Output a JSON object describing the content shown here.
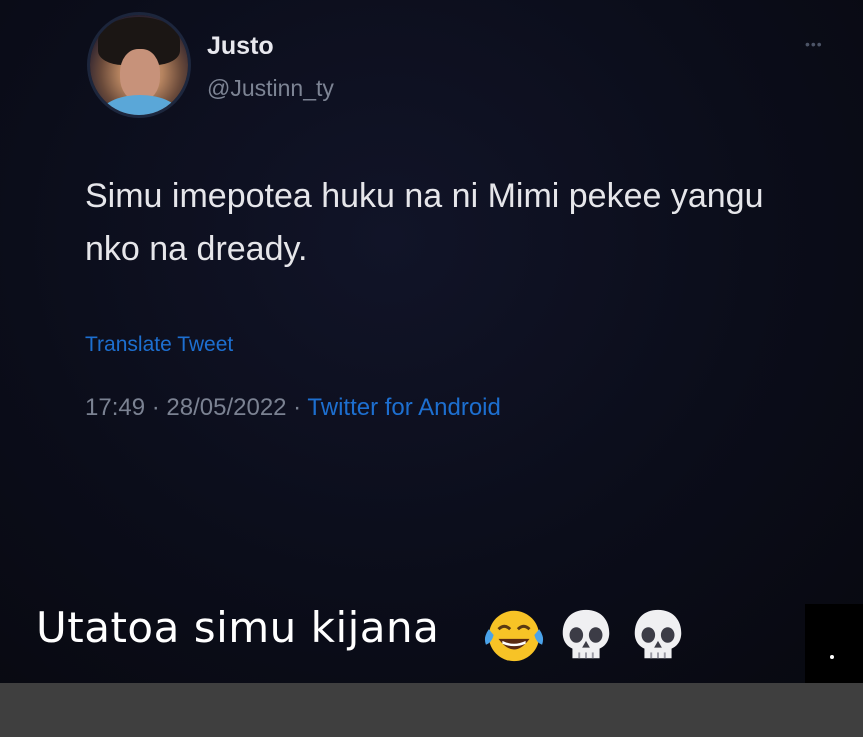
{
  "tweet": {
    "display_name": "Justo",
    "handle": "@Justinn_ty",
    "more_icon": "more-icon",
    "text": "Simu imepotea huku na ni Mimi pekee yangu nko na dready.",
    "translate_label": "Translate Tweet",
    "time": "17:49",
    "separator": " · ",
    "date": "28/05/2022",
    "source": "Twitter for Android"
  },
  "caption": {
    "text": "Utatoa simu kijana",
    "emojis": [
      "face-with-tears-of-joy-icon",
      "skull-icon",
      "skull-icon"
    ]
  },
  "colors": {
    "background": "#0b0d1a",
    "link_blue": "#1d6fd0",
    "muted_gray": "#7b8292",
    "bottom_bar": "#3f3f3f"
  }
}
